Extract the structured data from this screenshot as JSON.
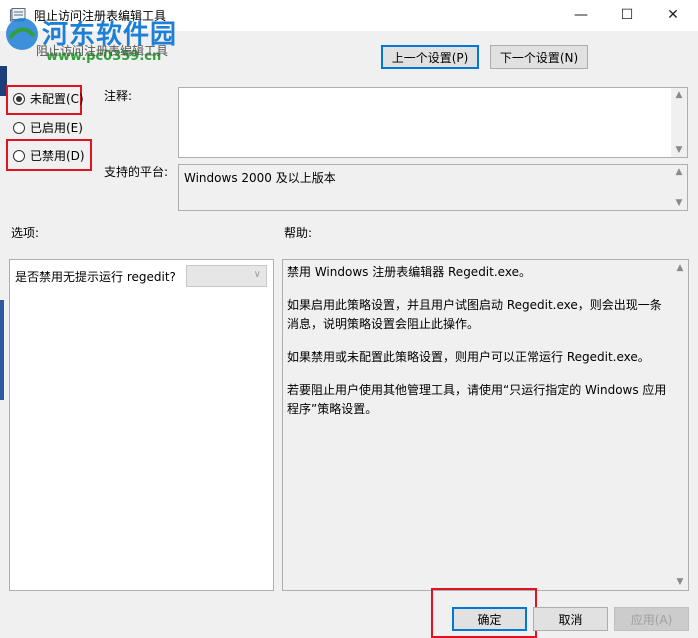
{
  "window": {
    "title": "阻止访问注册表编辑工具",
    "minimize_glyph": "—",
    "maximize_glyph": "☐",
    "close_glyph": "✕"
  },
  "watermark": {
    "name": "河东软件园",
    "url": "www.pc0359.cn"
  },
  "header": {
    "policy_title": "阻止访问注册表编辑工具",
    "prev_button": "上一个设置(P)",
    "next_button": "下一个设置(N)"
  },
  "state": {
    "options": [
      {
        "label": "未配置(C)",
        "selected": true
      },
      {
        "label": "已启用(E)",
        "selected": false
      },
      {
        "label": "已禁用(D)",
        "selected": false
      }
    ]
  },
  "comment": {
    "label": "注释:",
    "value": ""
  },
  "platform": {
    "label": "支持的平台:",
    "value": "Windows 2000 及以上版本"
  },
  "options_panel": {
    "label": "选项:",
    "setting_label": "是否禁用无提示运行 regedit?",
    "dropdown_value": ""
  },
  "help_panel": {
    "label": "帮助:",
    "paragraphs": [
      "禁用 Windows 注册表编辑器 Regedit.exe。",
      "如果启用此策略设置，并且用户试图启动 Regedit.exe，则会出现一条消息，说明策略设置会阻止此操作。",
      "如果禁用或未配置此策略设置，则用户可以正常运行 Regedit.exe。",
      "若要阻止用户使用其他管理工具，请使用“只运行指定的 Windows 应用程序”策略设置。"
    ]
  },
  "footer": {
    "ok": "确定",
    "cancel": "取消",
    "apply": "应用(A)"
  },
  "colors": {
    "highlight_red": "#e0141e",
    "accent_blue": "#0078d7",
    "watermark_blue": "#1e7fd6",
    "watermark_green": "#31a03a"
  }
}
